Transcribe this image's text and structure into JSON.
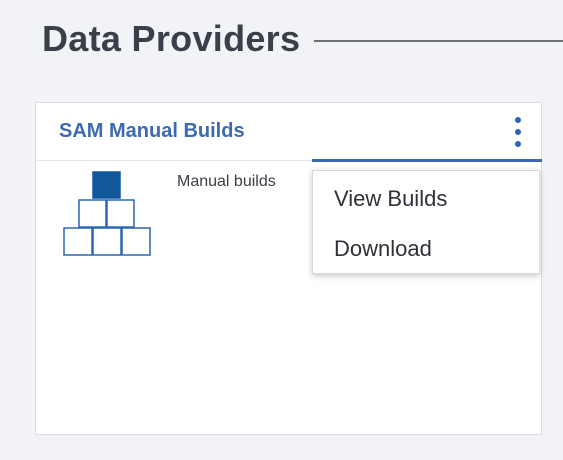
{
  "section": {
    "title": "Data Providers"
  },
  "card": {
    "title": "SAM Manual Builds",
    "description": "Manual builds",
    "icon": "pyramid-blocks-icon",
    "accent_color": "#3d6ab0",
    "icon_highlight_color": "#12579c"
  },
  "menu": {
    "items": [
      {
        "label": "View Builds"
      },
      {
        "label": "Download"
      }
    ]
  }
}
